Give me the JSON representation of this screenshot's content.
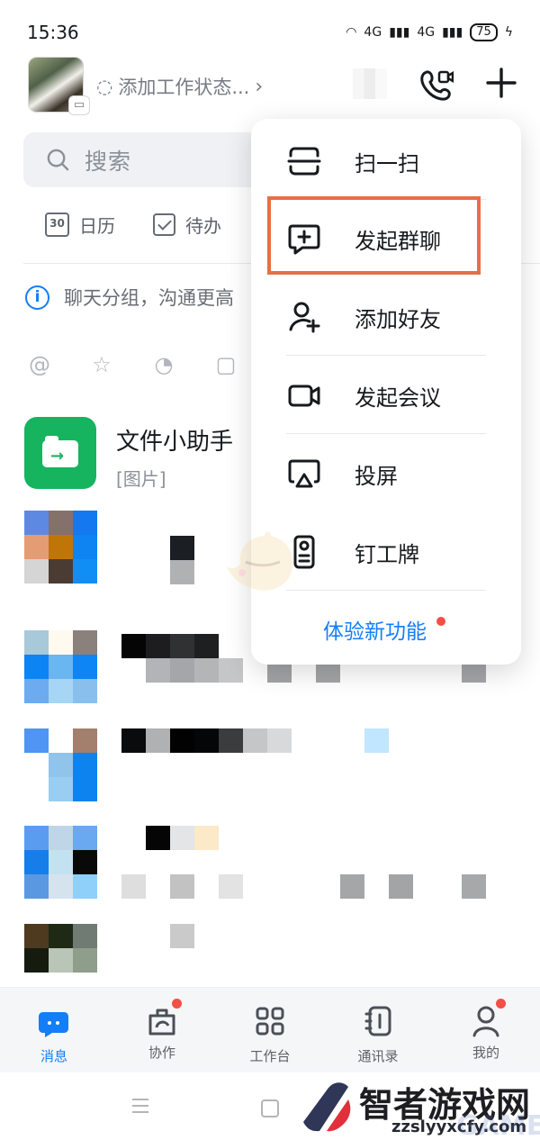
{
  "status_bar": {
    "time": "15:36",
    "network_1": "4G",
    "network_2": "4G",
    "battery": "75"
  },
  "header": {
    "work_status": "添加工作状态...",
    "icons": [
      "mosaic-icon",
      "video-call-icon",
      "plus-icon"
    ]
  },
  "search": {
    "placeholder": "搜索"
  },
  "quick_actions": {
    "calendar_day": "30",
    "calendar": "日历",
    "todo": "待办"
  },
  "info": {
    "text": "聊天分组，沟通更高"
  },
  "chat_list": {
    "file_helper": {
      "title": "文件小助手",
      "subtitle": "[图片]"
    }
  },
  "menu": {
    "items": [
      {
        "label": "扫一扫",
        "icon": "scan-icon"
      },
      {
        "label": "发起群聊",
        "icon": "group-chat-icon"
      },
      {
        "label": "添加好友",
        "icon": "add-friend-icon"
      },
      {
        "label": "发起会议",
        "icon": "video-meeting-icon"
      },
      {
        "label": "投屏",
        "icon": "screen-cast-icon"
      },
      {
        "label": "钉工牌",
        "icon": "badge-icon"
      }
    ],
    "new_feature": "体验新功能"
  },
  "bottom_nav": {
    "items": [
      {
        "label": "消息",
        "icon": "chat-icon",
        "active": true
      },
      {
        "label": "协作",
        "icon": "collaboration-icon",
        "dot": true
      },
      {
        "label": "工作台",
        "icon": "workspace-icon"
      },
      {
        "label": "通讯录",
        "icon": "contacts-icon"
      },
      {
        "label": "我的",
        "icon": "profile-icon",
        "dot": true
      }
    ]
  },
  "watermark": {
    "title": "智者游戏网",
    "url": "zzslyyxcfy.com",
    "game_text": "GAME"
  },
  "colors": {
    "accent": "#137EF8",
    "highlight": "#E66F45",
    "file_helper": "#16B45F",
    "notification_dot": "#F24F46"
  }
}
